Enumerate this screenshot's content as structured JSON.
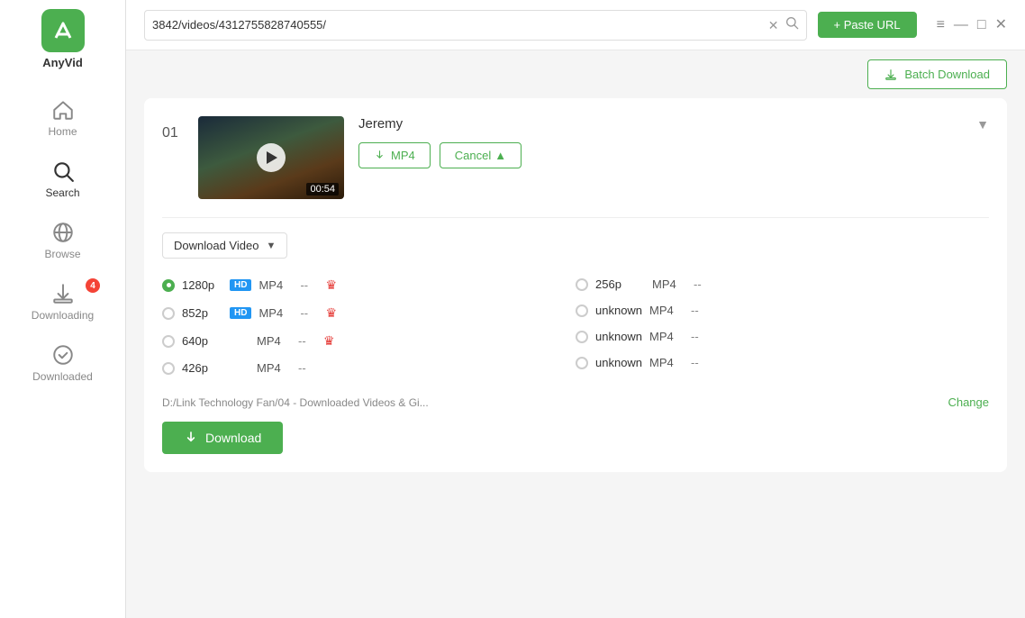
{
  "app": {
    "name": "AnyVid"
  },
  "topbar": {
    "url": "3842/videos/4312755828740555/",
    "paste_label": "+ Paste URL"
  },
  "batch": {
    "label": "Batch Download"
  },
  "video": {
    "index": "01",
    "title": "Jeremy",
    "duration": "00:54",
    "mp4_label": "MP4",
    "cancel_label": "Cancel"
  },
  "download_type": {
    "label": "Download Video",
    "arrow": "▼"
  },
  "quality_options_left": [
    {
      "id": "q1280",
      "resolution": "1280p",
      "hd": true,
      "format": "MP4",
      "dash": "--",
      "crown": true,
      "checked": true
    },
    {
      "id": "q852",
      "resolution": "852p",
      "hd": true,
      "format": "MP4",
      "dash": "--",
      "crown": true,
      "checked": false
    },
    {
      "id": "q640",
      "resolution": "640p",
      "hd": false,
      "format": "MP4",
      "dash": "--",
      "crown": true,
      "checked": false
    },
    {
      "id": "q426",
      "resolution": "426p",
      "hd": false,
      "format": "MP4",
      "dash": "--",
      "crown": false,
      "checked": false
    }
  ],
  "quality_options_right": [
    {
      "id": "q256",
      "resolution": "256p",
      "hd": false,
      "format": "MP4",
      "dash": "--",
      "crown": false,
      "checked": false
    },
    {
      "id": "qunk1",
      "resolution": "unknown",
      "hd": false,
      "format": "MP4",
      "dash": "--",
      "crown": false,
      "checked": false
    },
    {
      "id": "qunk2",
      "resolution": "unknown",
      "hd": false,
      "format": "MP4",
      "dash": "--",
      "crown": false,
      "checked": false
    },
    {
      "id": "qunk3",
      "resolution": "unknown",
      "hd": false,
      "format": "MP4",
      "dash": "--",
      "crown": false,
      "checked": false
    }
  ],
  "path": {
    "text": "D:/Link Technology Fan/04 - Downloaded Videos & Gi...",
    "change_label": "Change"
  },
  "download_btn": {
    "label": "Download"
  },
  "sidebar": {
    "items": [
      {
        "id": "home",
        "label": "Home"
      },
      {
        "id": "search",
        "label": "Search"
      },
      {
        "id": "browse",
        "label": "Browse"
      },
      {
        "id": "downloading",
        "label": "Downloading",
        "badge": "4"
      },
      {
        "id": "downloaded",
        "label": "Downloaded"
      }
    ]
  },
  "window_controls": [
    "≡",
    "—",
    "□",
    "✕"
  ]
}
